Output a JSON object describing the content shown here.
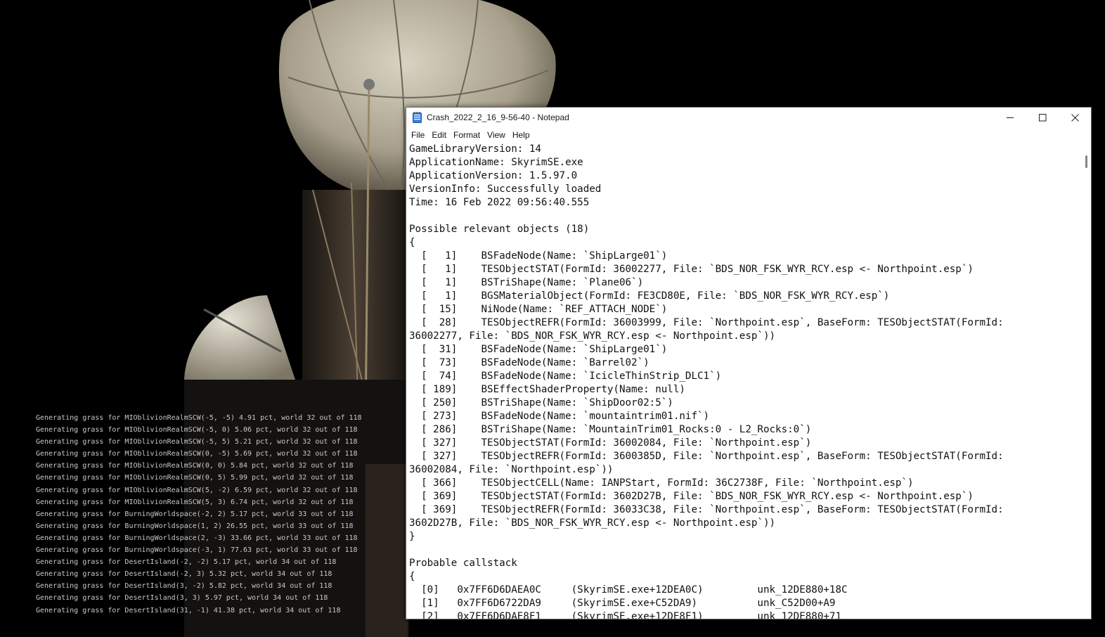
{
  "colors": {
    "background": "#000000",
    "console_text": "#c9c9c9",
    "notepad_bg": "#ffffff",
    "notepad_text": "#111111"
  },
  "console": {
    "lines": [
      "Generating grass for MIOblivionRealmSCW(-5, -5) 4.91 pct, world 32 out of 118",
      "Generating grass for MIOblivionRealmSCW(-5, 0) 5.06 pct, world 32 out of 118",
      "Generating grass for MIOblivionRealmSCW(-5, 5) 5.21 pct, world 32 out of 118",
      "Generating grass for MIOblivionRealmSCW(0, -5) 5.69 pct, world 32 out of 118",
      "Generating grass for MIOblivionRealmSCW(0, 0) 5.84 pct, world 32 out of 118",
      "Generating grass for MIOblivionRealmSCW(0, 5) 5.99 pct, world 32 out of 118",
      "Generating grass for MIOblivionRealmSCW(5, -2) 6.59 pct, world 32 out of 118",
      "Generating grass for MIOblivionRealmSCW(5, 3) 6.74 pct, world 32 out of 118",
      "Generating grass for BurningWorldspace(-2, 2) 5.17 pct, world 33 out of 118",
      "Generating grass for BurningWorldspace(1, 2) 26.55 pct, world 33 out of 118",
      "Generating grass for BurningWorldspace(2, -3) 33.66 pct, world 33 out of 118",
      "Generating grass for BurningWorldspace(-3, 1) 77.63 pct, world 33 out of 118",
      "Generating grass for DesertIsland(-2, -2) 5.17 pct, world 34 out of 118",
      "Generating grass for DesertIsland(-2, 3) 5.32 pct, world 34 out of 118",
      "Generating grass for DesertIsland(3, -2) 5.82 pct, world 34 out of 118",
      "Generating grass for DesertIsland(3, 3) 5.97 pct, world 34 out of 118",
      "Generating grass for DesertIsland(31, -1) 41.38 pct, world 34 out of 118"
    ]
  },
  "notepad": {
    "title": "Crash_2022_2_16_9-56-40 - Notepad",
    "icon": "notepad-icon",
    "menu": [
      "File",
      "Edit",
      "Format",
      "View",
      "Help"
    ],
    "lines": [
      "GameLibraryVersion: 14",
      "ApplicationName: SkyrimSE.exe",
      "ApplicationVersion: 1.5.97.0",
      "VersionInfo: Successfully loaded",
      "Time: 16 Feb 2022 09:56:40.555",
      "",
      "Possible relevant objects (18)",
      "{",
      "  [   1]    BSFadeNode(Name: `ShipLarge01`)",
      "  [   1]    TESObjectSTAT(FormId: 36002277, File: `BDS_NOR_FSK_WYR_RCY.esp <- Northpoint.esp`)",
      "  [   1]    BSTriShape(Name: `Plane06`)",
      "  [   1]    BGSMaterialObject(FormId: FE3CD80E, File: `BDS_NOR_FSK_WYR_RCY.esp`)",
      "  [  15]    NiNode(Name: `REF_ATTACH_NODE`)",
      "  [  28]    TESObjectREFR(FormId: 36003999, File: `Northpoint.esp`, BaseForm: TESObjectSTAT(FormId:",
      "36002277, File: `BDS_NOR_FSK_WYR_RCY.esp <- Northpoint.esp`))",
      "  [  31]    BSFadeNode(Name: `ShipLarge01`)",
      "  [  73]    BSFadeNode(Name: `Barrel02`)",
      "  [  74]    BSFadeNode(Name: `IcicleThinStrip_DLC1`)",
      "  [ 189]    BSEffectShaderProperty(Name: null)",
      "  [ 250]    BSTriShape(Name: `ShipDoor02:5`)",
      "  [ 273]    BSFadeNode(Name: `mountaintrim01.nif`)",
      "  [ 286]    BSTriShape(Name: `MountainTrim01_Rocks:0 - L2_Rocks:0`)",
      "  [ 327]    TESObjectSTAT(FormId: 36002084, File: `Northpoint.esp`)",
      "  [ 327]    TESObjectREFR(FormId: 3600385D, File: `Northpoint.esp`, BaseForm: TESObjectSTAT(FormId:",
      "36002084, File: `Northpoint.esp`))",
      "  [ 366]    TESObjectCELL(Name: IANPStart, FormId: 36C2738F, File: `Northpoint.esp`)",
      "  [ 369]    TESObjectSTAT(FormId: 3602D27B, File: `BDS_NOR_FSK_WYR_RCY.esp <- Northpoint.esp`)",
      "  [ 369]    TESObjectREFR(FormId: 36033C38, File: `Northpoint.esp`, BaseForm: TESObjectSTAT(FormId:",
      "3602D27B, File: `BDS_NOR_FSK_WYR_RCY.esp <- Northpoint.esp`))",
      "}",
      "",
      "Probable callstack",
      "{",
      "  [0]   0x7FF6D6DAEA0C     (SkyrimSE.exe+12DEA0C)         unk_12DE880+18C",
      "  [1]   0x7FF6D6722DA9     (SkyrimSE.exe+C52DA9)          unk_C52D00+A9",
      "  [2]   0x7FF6D6DAE8F1     (SkyrimSE.exe+12DE8F1)         unk_12DE880+71"
    ]
  }
}
